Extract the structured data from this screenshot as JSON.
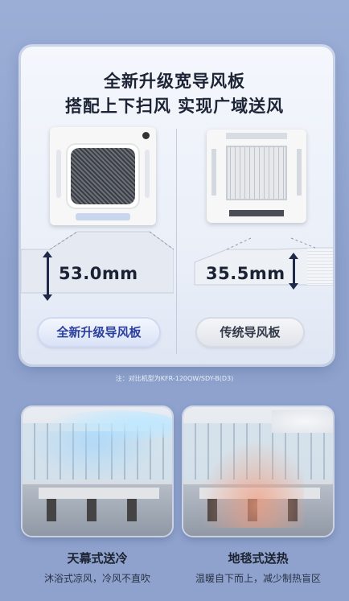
{
  "headline": {
    "line1": "全新升级宽导风板",
    "line2": "搭配上下扫风 实现广域送风"
  },
  "new_panel": {
    "measurement": "53.0mm",
    "label": "全新升级导风板"
  },
  "old_panel": {
    "measurement": "35.5mm",
    "label": "传统导风板"
  },
  "footnote": "注：对比机型为KFR-120QW/SDY-B(D3)",
  "modes": [
    {
      "title": "天幕式送冷",
      "subtitle": "沐浴式凉风，冷风不直吹"
    },
    {
      "title": "地毯式送热",
      "subtitle": "温暖自下而上，减少制热盲区"
    }
  ],
  "colors": {
    "page_bg": "#8ea2cd",
    "accent_blue": "#2b3f9e",
    "cool_air": "#bfe8ff",
    "warm_air": "#f29a7a"
  }
}
